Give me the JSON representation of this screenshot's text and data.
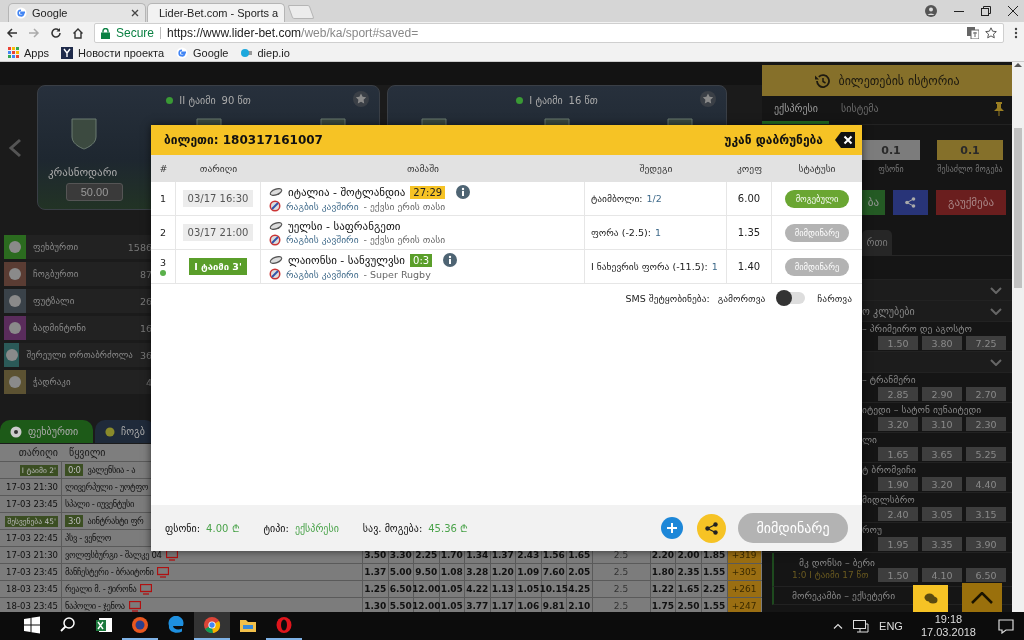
{
  "browser": {
    "tabs": [
      {
        "title": "Google",
        "kind": "google",
        "selected": false
      },
      {
        "title": "Lider-Bet.com - Sports a",
        "kind": "liderbet",
        "selected": true
      }
    ],
    "secure_label": "Secure",
    "url": {
      "host": "https://www.lider-bet.com",
      "path": "/web/ka/sport#saved="
    },
    "bookmarks": [
      {
        "label": "Apps",
        "kind": "apps"
      },
      {
        "label": "Новости проекта",
        "kind": "y"
      },
      {
        "label": "Google",
        "kind": "google"
      },
      {
        "label": "diep.io",
        "kind": "diep"
      }
    ]
  },
  "carousel": {
    "cards": [
      {
        "period": "II ტაიმი",
        "minute": "90 წთ",
        "team": "კრასნოდარი",
        "odds": "50.00"
      },
      {
        "period": "I ტაიმი",
        "minute": "16 წთ"
      }
    ]
  },
  "sports": [
    {
      "name": "ფეხბურთი",
      "count": "1586",
      "color": "#2b6b1f"
    },
    {
      "name": "ჩოგბურთი",
      "count": "87",
      "color": "#5a3c33"
    },
    {
      "name": "ფუტზალი",
      "count": "26",
      "color": "#3a4249"
    },
    {
      "name": "ბადმინტონი",
      "count": "16",
      "color": "#5a2c5c"
    },
    {
      "name": "შერეული ორთაბრძოლა",
      "count": "36",
      "color": "#2b5a58"
    },
    {
      "name": "ჭადრაკი",
      "count": "4",
      "color": "#5c5232"
    }
  ],
  "events": {
    "tabs": [
      {
        "label": "ფეხბურთი",
        "selected": true
      },
      {
        "label": "ჩოგბ",
        "selected": false
      }
    ],
    "columns": [
      "თარიღი",
      "წყვილი"
    ],
    "rows": [
      {
        "live": true,
        "time": "I ტაიმი 2'",
        "score": "0:0",
        "match": "ვალენსია - ა",
        "tv": false
      },
      {
        "live": false,
        "time": "17-03 21:30",
        "match": "ლივერპული - უოტფო",
        "tv": false
      },
      {
        "live": false,
        "time": "17-03 23:45",
        "match": "სპალი - იუვენტუსი",
        "tv": false
      },
      {
        "live": true,
        "time": "შესვენება 45'",
        "score": "3:0",
        "match": "აინტრახტი ფრ",
        "tv": false
      },
      {
        "live": false,
        "time": "17-03 22:45",
        "match": "პსვ - ვენლო",
        "tv": false
      },
      {
        "live": false,
        "time": "17-03 21:30",
        "match": "ვოლფსბურგი - შალკე 04",
        "tv": true,
        "odds": [
          "3.50",
          "3.30",
          "2.25",
          "1.70",
          "1.34",
          "1.37",
          "2.43",
          "1.56",
          "1.65"
        ],
        "total": "2.5",
        "odds2": [
          "2.20",
          "2.00",
          "1.85"
        ],
        "more": "+319"
      },
      {
        "live": false,
        "time": "17-03 23:45",
        "match": "მანჩესტერი - ბრაიტონი",
        "tv": true,
        "odds": [
          "1.37",
          "5.00",
          "9.50",
          "1.08",
          "3.28",
          "1.20",
          "1.09",
          "7.60",
          "2.05"
        ],
        "total": "2.5",
        "odds2": [
          "1.80",
          "2.35",
          "1.55"
        ],
        "more": "+305"
      },
      {
        "live": false,
        "time": "18-03 23:45",
        "match": "რეალი მ. - ჟირონა",
        "tv": true,
        "odds": [
          "1.25",
          "6.50",
          "12.00",
          "1.05",
          "4.22",
          "1.13",
          "1.05",
          "10.15",
          "4.25"
        ],
        "total": "2.5",
        "odds2": [
          "1.22",
          "1.65",
          "2.25"
        ],
        "more": "+261"
      },
      {
        "live": false,
        "time": "18-03 23:45",
        "match": "ნაპოლი - ჯენოა",
        "tv": true,
        "odds": [
          "1.30",
          "5.50",
          "12.00",
          "1.05",
          "3.77",
          "1.17",
          "1.06",
          "9.81",
          "2.10"
        ],
        "total": "2.5",
        "odds2": [
          "1.75",
          "2.50",
          "1.55"
        ],
        "more": "+247"
      }
    ]
  },
  "history": {
    "title": "ბილეთების ისტორია",
    "tabs": [
      {
        "label": "ექსპრესი",
        "selected": true
      },
      {
        "label": "სისტემა",
        "selected": false
      }
    ],
    "stake": {
      "value": "0.1",
      "label": "ფსონი"
    },
    "possible_win": {
      "value": "0.1",
      "label": "შესაძლო მოგება"
    },
    "confirm": "ბა",
    "cancel": "გაუქმება",
    "sport_tab": "რთი",
    "items": [
      {
        "kind": "blank"
      },
      {
        "kind": "group"
      },
      {
        "kind": "group",
        "title": "ო კლუბები"
      },
      {
        "kind": "match",
        "title": "– პრიმეირო დე აგოსტო",
        "odds": [
          "1.50",
          "3.80",
          "7.25"
        ]
      },
      {
        "kind": "group"
      },
      {
        "kind": "match",
        "title": "– ტრანმერი",
        "odds": [
          "2.85",
          "2.90",
          "2.70"
        ]
      },
      {
        "kind": "match",
        "title": "იტედი – სატონ იუნაიტედი",
        "odds": [
          "3.20",
          "3.10",
          "2.30"
        ]
      },
      {
        "kind": "match",
        "title": "ლი",
        "odds": [
          "1.65",
          "3.65",
          "5.25"
        ]
      },
      {
        "kind": "match",
        "title": "ტ ბრომვიჩი",
        "odds": [
          "1.90",
          "3.20",
          "4.40"
        ]
      },
      {
        "kind": "match",
        "title": "მიდლსბრო",
        "odds": [
          "2.40",
          "3.05",
          "3.15"
        ]
      },
      {
        "kind": "match",
        "title": "როუ",
        "odds": [
          "1.95",
          "3.35",
          "3.90"
        ]
      },
      {
        "kind": "live",
        "title": "მკ დონსი – ბერი",
        "score": "1:0",
        "time": "I ტაიმი 17 წთ",
        "odds": [
          "1.50",
          "4.10",
          "6.50"
        ]
      },
      {
        "kind": "last",
        "title": "მორეკამბი – ექსეტერი"
      }
    ]
  },
  "ticket": {
    "title": "ბილეთი: 180317161007",
    "back": "უკან დაბრუნება",
    "columns": [
      "#",
      "თარიღი",
      "თამაში",
      "შედეგი",
      "კოეფ",
      "სტატუსი"
    ],
    "bets": [
      {
        "index": "1",
        "live": false,
        "date": "03/17 16:30",
        "match": "იტალია - შოტლანდია",
        "score": "27:29",
        "info": true,
        "league_link": "რაგბის კავშირი",
        "league": "- ექვსი ერის თასი",
        "market": "ტაიმბოლი:",
        "pick": "1/2",
        "odds": "6.00",
        "status": {
          "label": "მოგებული",
          "kind": "won"
        }
      },
      {
        "index": "2",
        "live": false,
        "date": "03/17 21:00",
        "match": "უელსი - საფრანგეთი",
        "info": false,
        "league_link": "რაგბის კავშირი",
        "league": "- ექვსი ერის თასი",
        "market": "ფორა (-2.5):",
        "pick": "1",
        "odds": "1.35",
        "status": {
          "label": "მიმდინარე",
          "kind": "pending"
        }
      },
      {
        "index": "3",
        "live": true,
        "date": "I ტაიმი 3'",
        "match": "ლაიონსი - სანვულვსი",
        "score": "0:3",
        "info": true,
        "league_link": "რაგბის კავშირი",
        "league": "- Super Rugby",
        "market": "I ნახევრის ფორა (-11.5):",
        "pick": "1",
        "odds": "1.40",
        "status": {
          "label": "მიმდინარე",
          "kind": "pending"
        }
      }
    ],
    "sms": {
      "label": "SMS შეტყობინება:",
      "off": "გამორთვა",
      "on": "ჩართვა",
      "enabled": false
    },
    "footer": {
      "stake_label": "ფსონი:",
      "stake": "4.00 ₾",
      "type_label": "ტიპი:",
      "type": "ექსპრესი",
      "win_label": "სავ. მოგება:",
      "win": "45.36 ₾",
      "status": "მიმდინარე"
    }
  },
  "taskbar": {
    "language": "ENG",
    "time": "19:18",
    "date": "17.03.2018"
  }
}
